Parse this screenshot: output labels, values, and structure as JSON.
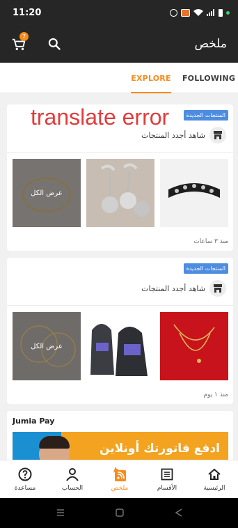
{
  "status_bar": {
    "time": "11:20"
  },
  "header": {
    "title": "ملخص",
    "cart_count": "7"
  },
  "tabs": [
    {
      "label": "EXPLORE",
      "active": true
    },
    {
      "label": "FOLLOWING",
      "active": false
    }
  ],
  "feed": [
    {
      "overlay_text": "translate error",
      "badge": "المنتجات الجديدة",
      "header_label": "شاهد أجدد المنتجات",
      "view_all": "عرض الكل",
      "time_ago": "منذ ٣ ساعات",
      "items": [
        "spiked leather bracelet",
        "silver ball earrings",
        "gold necklace"
      ]
    },
    {
      "badge": "المنتجات الجديدة",
      "header_label": "شاهد أجدد المنتجات",
      "view_all": "عرض الكل",
      "time_ago": "منذ ١ يوم",
      "items": [
        "gold chain necklace",
        "hoodies",
        "gold hoop earrings"
      ]
    }
  ],
  "jumia_pay": {
    "title": "Jumia Pay",
    "banner_text": "ادفع فاتورتك أونلاين"
  },
  "bottom_nav": [
    {
      "label": "الرئيسية",
      "icon": "home-icon",
      "active": false
    },
    {
      "label": "الأقسام",
      "icon": "categories-icon",
      "active": false
    },
    {
      "label": "ملخص",
      "icon": "feed-icon",
      "active": true
    },
    {
      "label": "الحساب",
      "icon": "account-icon",
      "active": false
    },
    {
      "label": "مساعدة",
      "icon": "help-icon",
      "active": false
    }
  ],
  "colors": {
    "accent": "#f68b1e",
    "header_bg": "#262626",
    "badge_blue": "#4c8ce1",
    "error_red": "#e23b3b"
  }
}
